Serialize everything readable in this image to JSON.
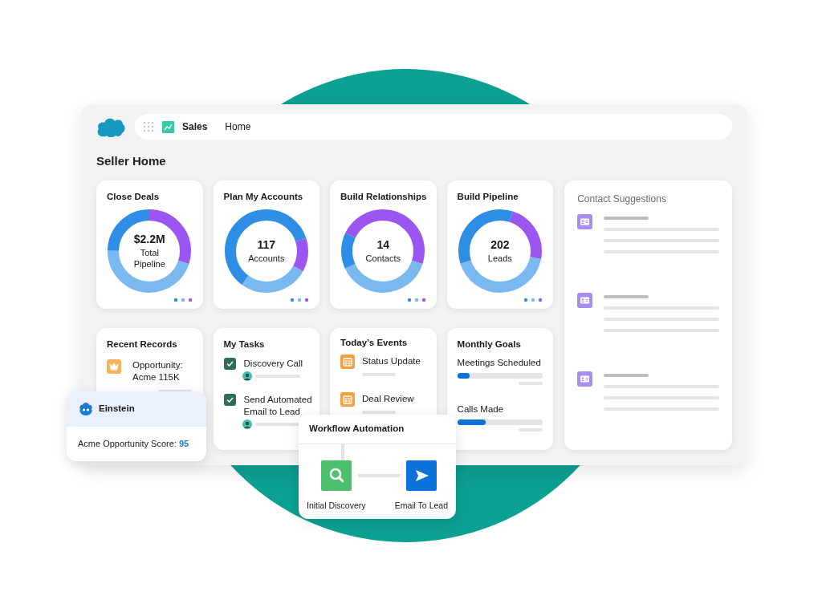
{
  "app": {
    "name": "Sales",
    "tab": "Home"
  },
  "page_title": "Seller Home",
  "metric_cards": [
    {
      "title": "Close Deals",
      "value": "$2.2M",
      "caption": "Total Pipeline"
    },
    {
      "title": "Plan My Accounts",
      "value": "117",
      "caption": "Accounts"
    },
    {
      "title": "Build Relationships",
      "value": "14",
      "caption": "Contacts"
    },
    {
      "title": "Build Pipeline",
      "value": "202",
      "caption": "Leads"
    }
  ],
  "contact_suggestions": {
    "title": "Contact Suggestions"
  },
  "recent_records": {
    "title": "Recent Records",
    "items": [
      {
        "label": "Opportunity: Acme 115K"
      }
    ]
  },
  "tasks": {
    "title": "My Tasks",
    "items": [
      {
        "label": "Discovery Call",
        "checked": true
      },
      {
        "label": "Send Automated Email to Lead",
        "checked": true
      }
    ]
  },
  "events": {
    "title": "Today’s Events",
    "items": [
      {
        "label": "Status Update"
      },
      {
        "label": "Deal Review"
      }
    ]
  },
  "goals": {
    "title": "Monthly Goals",
    "items": [
      {
        "label": "Meetings Scheduled",
        "level": 0.14
      },
      {
        "label": "Calls Made",
        "level": 0.33
      }
    ]
  },
  "einstein": {
    "title": "Einstein",
    "label": "Acme Opportunity Score:",
    "score": "95"
  },
  "workflow": {
    "title": "Workflow Automation",
    "steps": [
      {
        "label": "Initial Discovery",
        "kind": "search"
      },
      {
        "label": "Email To Lead",
        "kind": "send"
      }
    ]
  }
}
